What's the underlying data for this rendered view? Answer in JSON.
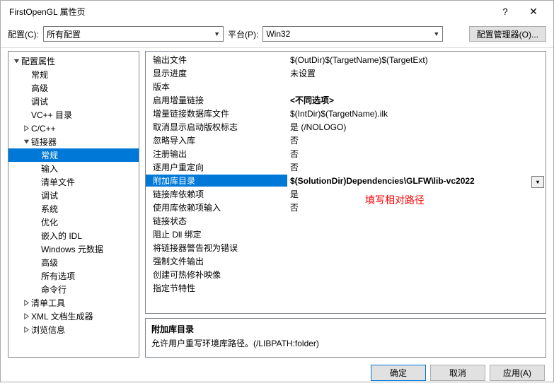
{
  "window": {
    "title": "FirstOpenGL 属性页"
  },
  "toolbar": {
    "config_label": "配置(C):",
    "config_value": "所有配置",
    "platform_label": "平台(P):",
    "platform_value": "Win32",
    "manager_label": "配置管理器(O)..."
  },
  "tree": [
    {
      "label": "配置属性",
      "indent": 0,
      "arrow": "down"
    },
    {
      "label": "常规",
      "indent": 1,
      "arrow": ""
    },
    {
      "label": "高级",
      "indent": 1,
      "arrow": ""
    },
    {
      "label": "调试",
      "indent": 1,
      "arrow": ""
    },
    {
      "label": "VC++ 目录",
      "indent": 1,
      "arrow": ""
    },
    {
      "label": "C/C++",
      "indent": 1,
      "arrow": "right"
    },
    {
      "label": "链接器",
      "indent": 1,
      "arrow": "down"
    },
    {
      "label": "常规",
      "indent": 2,
      "arrow": "",
      "selected": true
    },
    {
      "label": "输入",
      "indent": 2,
      "arrow": ""
    },
    {
      "label": "清单文件",
      "indent": 2,
      "arrow": ""
    },
    {
      "label": "调试",
      "indent": 2,
      "arrow": ""
    },
    {
      "label": "系统",
      "indent": 2,
      "arrow": ""
    },
    {
      "label": "优化",
      "indent": 2,
      "arrow": ""
    },
    {
      "label": "嵌入的 IDL",
      "indent": 2,
      "arrow": ""
    },
    {
      "label": "Windows 元数据",
      "indent": 2,
      "arrow": ""
    },
    {
      "label": "高级",
      "indent": 2,
      "arrow": ""
    },
    {
      "label": "所有选项",
      "indent": 2,
      "arrow": ""
    },
    {
      "label": "命令行",
      "indent": 2,
      "arrow": ""
    },
    {
      "label": "清单工具",
      "indent": 1,
      "arrow": "right"
    },
    {
      "label": "XML 文档生成器",
      "indent": 1,
      "arrow": "right"
    },
    {
      "label": "浏览信息",
      "indent": 1,
      "arrow": "right"
    }
  ],
  "grid": [
    {
      "key": "输出文件",
      "val": "$(OutDir)$(TargetName)$(TargetExt)"
    },
    {
      "key": "显示进度",
      "val": "未设置"
    },
    {
      "key": "版本",
      "val": ""
    },
    {
      "key": "启用增量链接",
      "val": "<不同选项>",
      "valbold": true
    },
    {
      "key": "增量链接数据库文件",
      "val": "$(IntDir)$(TargetName).ilk"
    },
    {
      "key": "取消显示启动版权标志",
      "val": "是 (/NOLOGO)"
    },
    {
      "key": "忽略导入库",
      "val": "否"
    },
    {
      "key": "注册输出",
      "val": "否"
    },
    {
      "key": "逐用户重定向",
      "val": "否"
    },
    {
      "key": "附加库目录",
      "val": "$(SolutionDir)Dependencies\\GLFW\\lib-vc2022",
      "selected": true
    },
    {
      "key": "链接库依赖项",
      "val": "是"
    },
    {
      "key": "使用库依赖项输入",
      "val": "否"
    },
    {
      "key": "链接状态",
      "val": ""
    },
    {
      "key": "阻止 Dll 绑定",
      "val": ""
    },
    {
      "key": "将链接器警告视为错误",
      "val": ""
    },
    {
      "key": "强制文件输出",
      "val": ""
    },
    {
      "key": "创建可热修补映像",
      "val": ""
    },
    {
      "key": "指定节特性",
      "val": ""
    }
  ],
  "annotation": "填写相对路径",
  "description": {
    "title": "附加库目录",
    "text": "允许用户重写环境库路径。(/LIBPATH:folder)"
  },
  "footer": {
    "ok": "确定",
    "cancel": "取消",
    "apply": "应用(A)"
  }
}
